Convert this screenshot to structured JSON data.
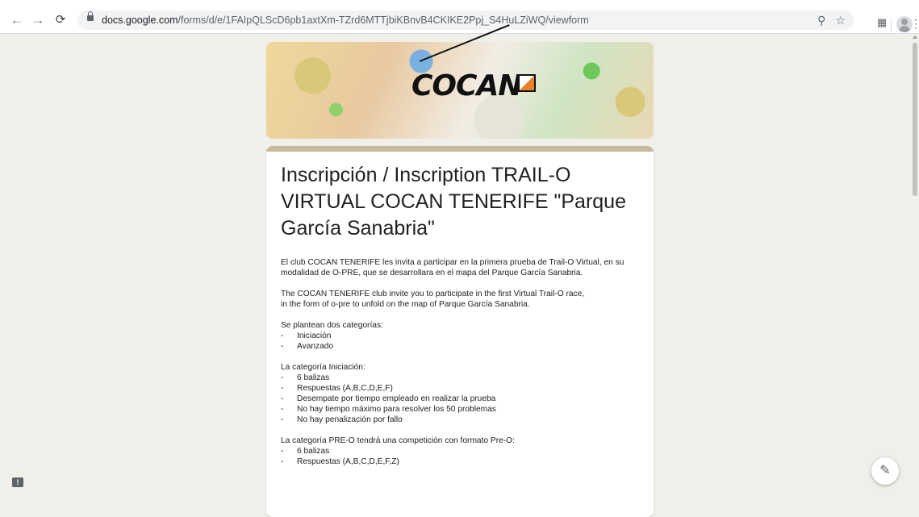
{
  "browser": {
    "url_host": "docs.google.com",
    "url_path": "/forms/d/e/1FAIpQLScD6pb1axtXm-TZrd6MTTjbiKBnvB4CKIKE2Ppj_S4HuLZiWQ/viewform",
    "icons": {
      "back": "back-arrow-icon",
      "forward": "forward-arrow-icon",
      "reload": "reload-icon",
      "zoom": "zoom-icon",
      "bookmark": "star-icon",
      "extensions": "extensions-icon",
      "profile": "profile-avatar-icon",
      "menu": "kebab-menu-icon"
    }
  },
  "form": {
    "accent_color": "#c7b99b",
    "background_color": "#f1efea",
    "header_logo_text": "COCAN",
    "title": "Inscripción / Inscription TRAIL-O\nVIRTUAL COCAN TENERIFE \"Parque\nGarcía Sanabria\"",
    "description": {
      "intro_es": "El club COCAN TENERIFE les invita a participar en la primera prueba de Trail-O Virtual, en su\nmodalidad de O-PRE, que se desarrollara en el mapa del Parque García Sanabria.",
      "intro_en": "The COCAN TENERIFE club invite you to participate in the first Virtual Trail-O race,\nin the form of o-pre to unfold on the map of Parque García Sanabria.",
      "categories_heading": "Se plantean dos categorías:",
      "categories": [
        "Iniciación",
        "Avanzado"
      ],
      "iniciacion_heading": "La categoría Iniciación:",
      "iniciacion_items": [
        "6 balizas",
        "Respuestas (A,B,C,D,E,F)",
        "Desempate por tiempo empleado en realizar la prueba",
        "No hay tiempo máximo para resolver los 50 problemas",
        "No hay penalización por fallo"
      ],
      "preo_heading": "La categoría PRE-O tendrá una competición con formato Pre-O:",
      "preo_items": [
        "6 balizas",
        "Respuestas (A,B,C,D,E,F,Z)"
      ]
    }
  },
  "fab": {
    "icon": "pencil-icon"
  },
  "feedback": {
    "icon": "feedback-icon",
    "glyph": "!"
  }
}
